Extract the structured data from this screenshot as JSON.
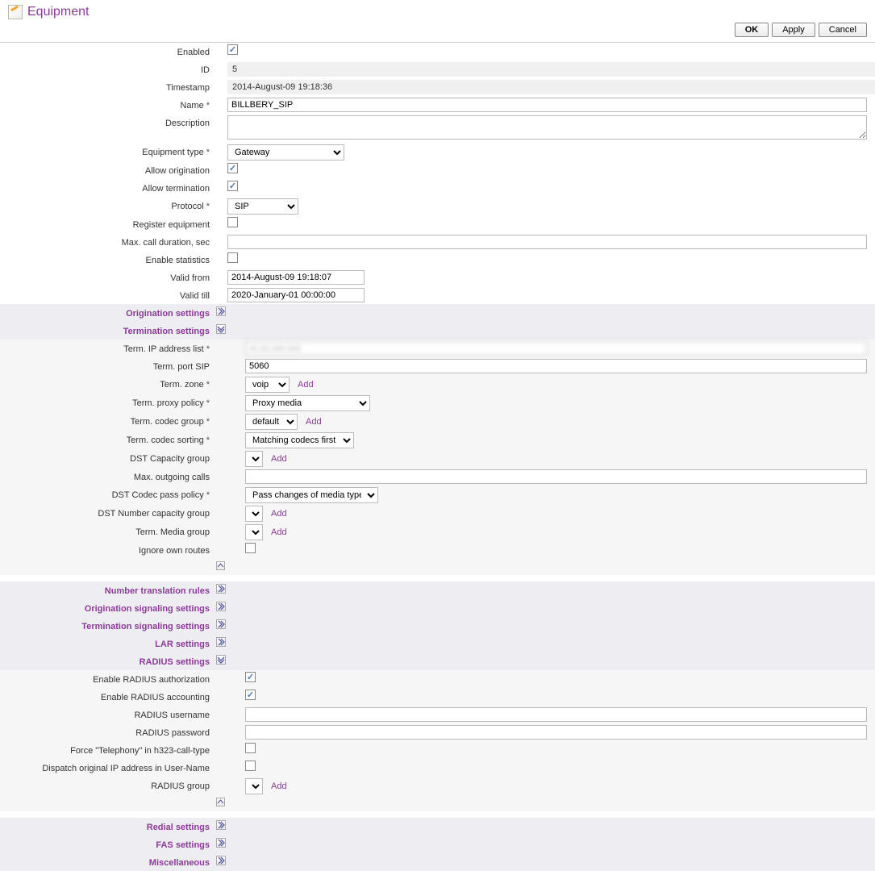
{
  "page": {
    "title": "Equipment"
  },
  "buttons": {
    "ok": "OK",
    "apply": "Apply",
    "cancel": "Cancel"
  },
  "fields": {
    "enabled": {
      "label": "Enabled",
      "checked": true
    },
    "id": {
      "label": "ID",
      "value": "5"
    },
    "timestamp": {
      "label": "Timestamp",
      "value": "2014-August-09 19:18:36"
    },
    "name": {
      "label": "Name",
      "value": "BILLBERY_SIP",
      "required": true
    },
    "description": {
      "label": "Description",
      "value": ""
    },
    "equipment_type": {
      "label": "Equipment type",
      "value": "Gateway",
      "required": true
    },
    "allow_origination": {
      "label": "Allow origination",
      "checked": true
    },
    "allow_termination": {
      "label": "Allow termination",
      "checked": true
    },
    "protocol": {
      "label": "Protocol",
      "value": "SIP",
      "required": true
    },
    "register_equipment": {
      "label": "Register equipment",
      "checked": false
    },
    "max_call_duration": {
      "label": "Max. call duration, sec",
      "value": ""
    },
    "enable_statistics": {
      "label": "Enable statistics",
      "checked": false
    },
    "valid_from": {
      "label": "Valid from",
      "value": "2014-August-09 19:18:07"
    },
    "valid_till": {
      "label": "Valid till",
      "value": "2020-January-01 00:00:00"
    }
  },
  "sections": {
    "origination_settings": {
      "label": "Origination settings",
      "expanded": false
    },
    "termination_settings": {
      "label": "Termination settings",
      "expanded": true,
      "fields": {
        "term_ip": {
          "label": "Term. IP address list",
          "value": "xx.xx.xxx.xxx",
          "required": true
        },
        "term_port": {
          "label": "Term. port SIP",
          "value": "5060"
        },
        "term_zone": {
          "label": "Term. zone",
          "value": "voip",
          "required": true,
          "add": "Add"
        },
        "term_proxy_policy": {
          "label": "Term. proxy policy",
          "value": "Proxy media",
          "required": true
        },
        "term_codec_group": {
          "label": "Term. codec group",
          "value": "default",
          "required": true,
          "add": "Add"
        },
        "term_codec_sorting": {
          "label": "Term. codec sorting",
          "value": "Matching codecs first",
          "required": true
        },
        "dst_capacity_group": {
          "label": "DST Capacity group",
          "value": "",
          "add": "Add"
        },
        "max_outgoing": {
          "label": "Max. outgoing calls",
          "value": ""
        },
        "dst_codec_pass": {
          "label": "DST Codec pass policy",
          "value": "Pass changes of media type",
          "required": true
        },
        "dst_number_cap": {
          "label": "DST Number capacity group",
          "value": "",
          "add": "Add"
        },
        "term_media_group": {
          "label": "Term. Media group",
          "value": "",
          "add": "Add"
        },
        "ignore_own_routes": {
          "label": "Ignore own routes",
          "checked": false
        }
      }
    },
    "number_translation": {
      "label": "Number translation rules",
      "expanded": false
    },
    "origination_signaling": {
      "label": "Origination signaling settings",
      "expanded": false
    },
    "termination_signaling": {
      "label": "Termination signaling settings",
      "expanded": false
    },
    "lar": {
      "label": "LAR settings",
      "expanded": false
    },
    "radius": {
      "label": "RADIUS settings",
      "expanded": true,
      "fields": {
        "enable_auth": {
          "label": "Enable RADIUS authorization",
          "checked": true
        },
        "enable_acct": {
          "label": "Enable RADIUS accounting",
          "checked": true
        },
        "username": {
          "label": "RADIUS username",
          "value": ""
        },
        "password": {
          "label": "RADIUS password",
          "value": ""
        },
        "force_telephony": {
          "label": "Force \"Telephony\" in h323-call-type",
          "checked": false
        },
        "dispatch_ip": {
          "label": "Dispatch original IP address in User-Name",
          "checked": false
        },
        "radius_group": {
          "label": "RADIUS group",
          "value": "",
          "add": "Add"
        }
      }
    },
    "redial": {
      "label": "Redial settings",
      "expanded": false
    },
    "fas": {
      "label": "FAS settings",
      "expanded": false
    },
    "misc": {
      "label": "Miscellaneous",
      "expanded": false
    }
  }
}
